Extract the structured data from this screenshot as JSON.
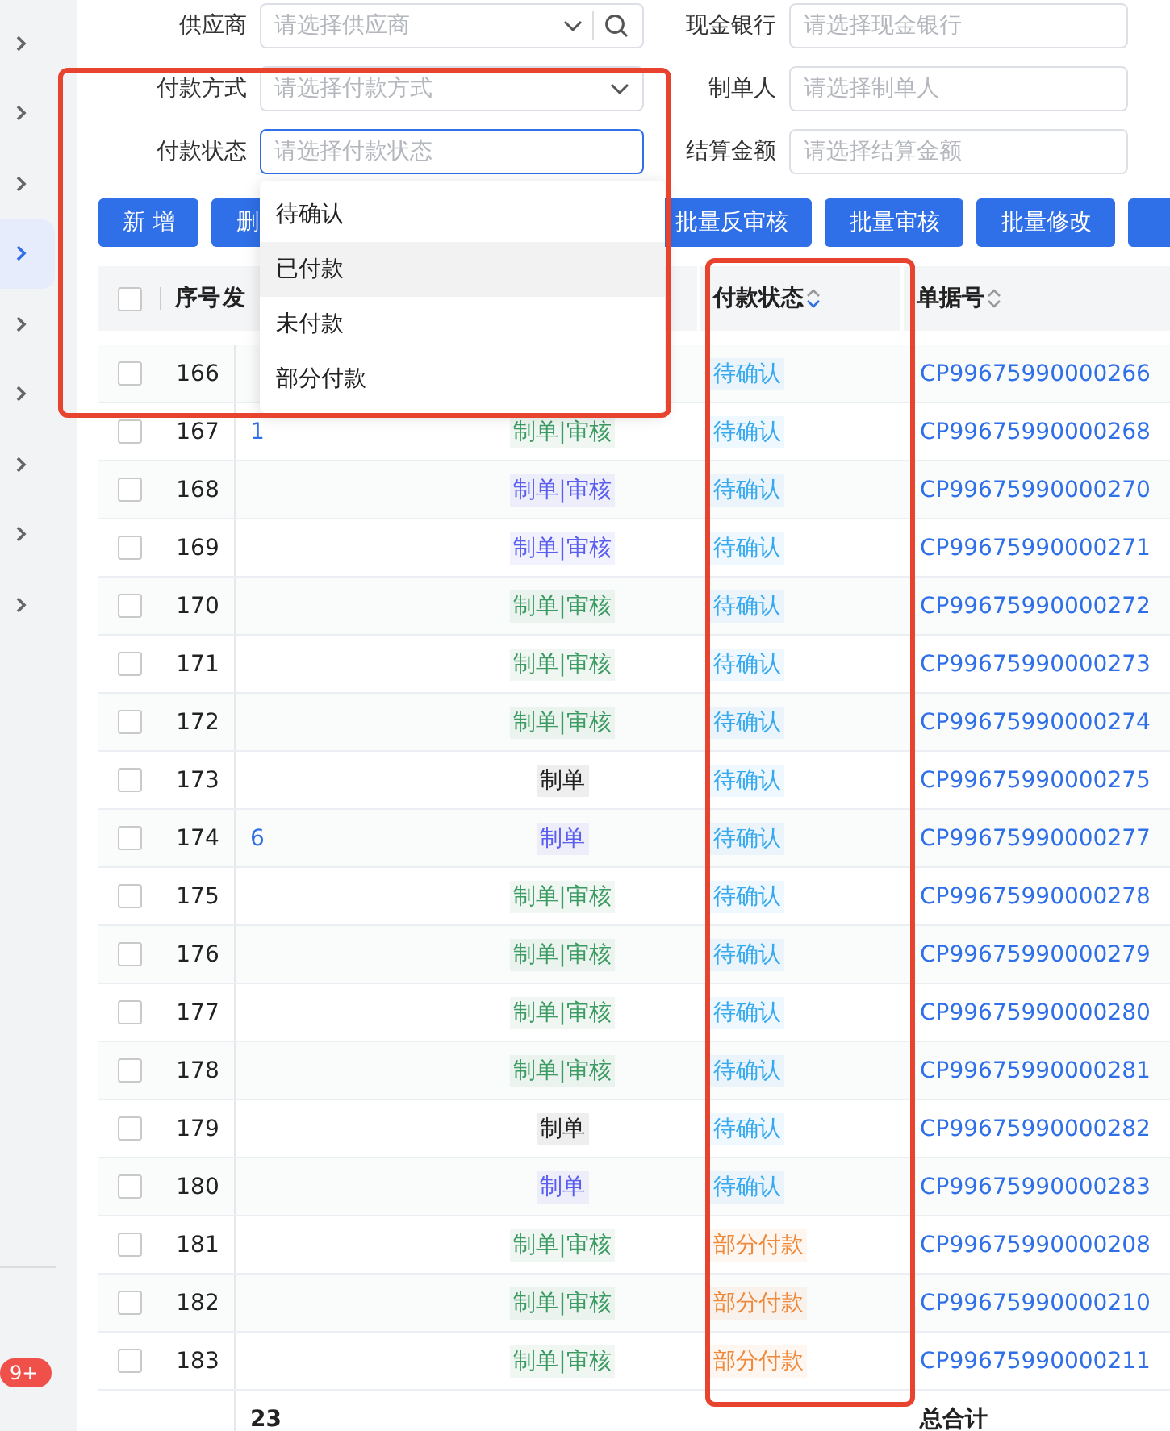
{
  "sidebar": {
    "items": [
      {
        "selected": false
      },
      {
        "selected": false
      },
      {
        "selected": false
      },
      {
        "selected": true
      },
      {
        "selected": false
      },
      {
        "selected": false
      },
      {
        "selected": false
      },
      {
        "selected": false
      },
      {
        "selected": false
      }
    ],
    "badge": "9+"
  },
  "filters": [
    {
      "label": "供应商",
      "placeholder": "请选择供应商",
      "kind": "search-select",
      "focused": false
    },
    {
      "label": "现金银行",
      "placeholder": "请选择现金银行",
      "kind": "input",
      "focused": false
    },
    {
      "label": "付款方式",
      "placeholder": "请选择付款方式",
      "kind": "select",
      "focused": false
    },
    {
      "label": "制单人",
      "placeholder": "请选择制单人",
      "kind": "input",
      "focused": false
    },
    {
      "label": "付款状态",
      "placeholder": "请选择付款状态",
      "kind": "input",
      "focused": true
    },
    {
      "label": "结算金额",
      "placeholder": "请选择结算金额",
      "kind": "input",
      "focused": false
    }
  ],
  "dropdown": {
    "options": [
      {
        "label": "待确认",
        "hovered": false
      },
      {
        "label": "已付款",
        "hovered": true
      },
      {
        "label": "未付款",
        "hovered": false
      },
      {
        "label": "部分付款",
        "hovered": false
      }
    ]
  },
  "buttons_left": [
    {
      "label": "新 增"
    },
    {
      "label": "删"
    }
  ],
  "buttons_right": [
    {
      "label": "批量反审核",
      "kind": "full"
    },
    {
      "label": "批量审核",
      "kind": "full"
    },
    {
      "label": "批量修改",
      "kind": "full"
    },
    {
      "kind": "cut"
    }
  ],
  "table": {
    "select_all": {
      "checked": false
    },
    "columns": [
      {
        "label": "序号"
      },
      {
        "label": "发"
      },
      {
        "label": "付款状态",
        "sorted_desc": true
      },
      {
        "label": "单据号",
        "sorted_desc": false
      }
    ],
    "rows": [
      {
        "seq": "166",
        "checked": false,
        "status": {
          "text": "待确认",
          "color": "#36a9ef"
        },
        "doc": "CP99675990000266"
      },
      {
        "seq": "167",
        "checked": false,
        "col3": "1",
        "audit": {
          "text": "制单|审核",
          "color": "#3c9b62"
        },
        "status": {
          "text": "待确认",
          "color": "#36a9ef"
        },
        "doc": "CP99675990000268"
      },
      {
        "seq": "168",
        "checked": false,
        "audit": {
          "text": "制单|审核",
          "color": "#5a5ef0"
        },
        "status": {
          "text": "待确认",
          "color": "#36a9ef"
        },
        "doc": "CP99675990000270"
      },
      {
        "seq": "169",
        "checked": false,
        "audit": {
          "text": "制单|审核",
          "color": "#5a5ef0"
        },
        "status": {
          "text": "待确认",
          "color": "#36a9ef"
        },
        "doc": "CP99675990000271"
      },
      {
        "seq": "170",
        "checked": false,
        "audit": {
          "text": "制单|审核",
          "color": "#3c9b62"
        },
        "status": {
          "text": "待确认",
          "color": "#36a9ef"
        },
        "doc": "CP99675990000272"
      },
      {
        "seq": "171",
        "checked": false,
        "audit": {
          "text": "制单|审核",
          "color": "#3c9b62"
        },
        "status": {
          "text": "待确认",
          "color": "#36a9ef"
        },
        "doc": "CP99675990000273"
      },
      {
        "seq": "172",
        "checked": false,
        "audit": {
          "text": "制单|审核",
          "color": "#3c9b62"
        },
        "status": {
          "text": "待确认",
          "color": "#36a9ef"
        },
        "doc": "CP99675990000274"
      },
      {
        "seq": "173",
        "checked": false,
        "audit": {
          "text": "制单",
          "color": "#222222"
        },
        "status": {
          "text": "待确认",
          "color": "#36a9ef"
        },
        "doc": "CP99675990000275"
      },
      {
        "seq": "174",
        "checked": false,
        "col3": "6",
        "audit": {
          "text": "制单",
          "color": "#5a5ef0"
        },
        "status": {
          "text": "待确认",
          "color": "#36a9ef"
        },
        "doc": "CP99675990000277"
      },
      {
        "seq": "175",
        "checked": false,
        "audit": {
          "text": "制单|审核",
          "color": "#3c9b62"
        },
        "status": {
          "text": "待确认",
          "color": "#36a9ef"
        },
        "doc": "CP99675990000278"
      },
      {
        "seq": "176",
        "checked": false,
        "audit": {
          "text": "制单|审核",
          "color": "#3c9b62"
        },
        "status": {
          "text": "待确认",
          "color": "#36a9ef"
        },
        "doc": "CP99675990000279"
      },
      {
        "seq": "177",
        "checked": false,
        "audit": {
          "text": "制单|审核",
          "color": "#3c9b62"
        },
        "status": {
          "text": "待确认",
          "color": "#36a9ef"
        },
        "doc": "CP99675990000280"
      },
      {
        "seq": "178",
        "checked": false,
        "audit": {
          "text": "制单|审核",
          "color": "#3c9b62"
        },
        "status": {
          "text": "待确认",
          "color": "#36a9ef"
        },
        "doc": "CP99675990000281"
      },
      {
        "seq": "179",
        "checked": false,
        "audit": {
          "text": "制单",
          "color": "#222222"
        },
        "status": {
          "text": "待确认",
          "color": "#36a9ef"
        },
        "doc": "CP99675990000282"
      },
      {
        "seq": "180",
        "checked": false,
        "audit": {
          "text": "制单",
          "color": "#5a5ef0"
        },
        "status": {
          "text": "待确认",
          "color": "#36a9ef"
        },
        "doc": "CP99675990000283"
      },
      {
        "seq": "181",
        "checked": false,
        "audit": {
          "text": "制单|审核",
          "color": "#3c9b62"
        },
        "status": {
          "text": "部分付款",
          "color": "#ef8a3c"
        },
        "doc": "CP99675990000208"
      },
      {
        "seq": "182",
        "checked": false,
        "audit": {
          "text": "制单|审核",
          "color": "#3c9b62"
        },
        "status": {
          "text": "部分付款",
          "color": "#ef8a3c"
        },
        "doc": "CP99675990000210"
      },
      {
        "seq": "183",
        "checked": false,
        "audit": {
          "text": "制单|审核",
          "color": "#3c9b62"
        },
        "status": {
          "text": "部分付款",
          "color": "#ef8a3c"
        },
        "doc": "CP99675990000211"
      }
    ],
    "footer": {
      "count": "23",
      "total_label": "总合计"
    }
  }
}
